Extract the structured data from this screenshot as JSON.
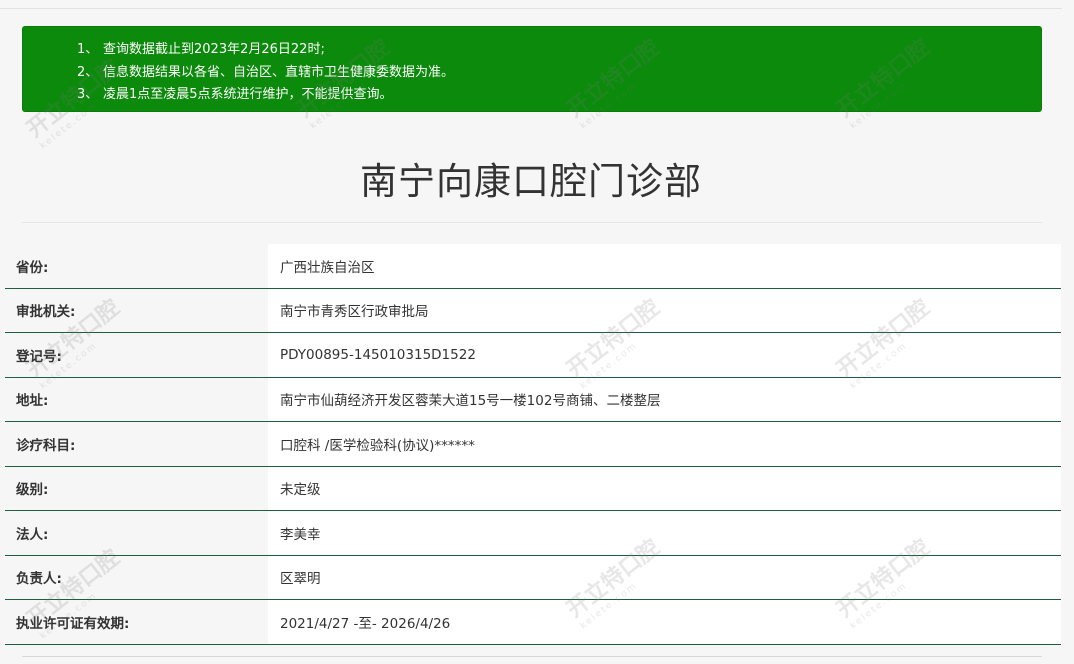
{
  "notice": {
    "items": [
      {
        "num": "1、",
        "text": "查询数据截止到2023年2月26日22时;"
      },
      {
        "num": "2、",
        "text": "信息数据结果以各省、自治区、直辖市卫生健康委数据为准。"
      },
      {
        "num": "3、",
        "text": "凌晨1点至凌晨5点系统进行维护，不能提供查询。"
      }
    ]
  },
  "clinic": {
    "name": "南宁向康口腔门诊部"
  },
  "details": {
    "rows": [
      {
        "label": "省份:",
        "value": "广西壮族自治区"
      },
      {
        "label": "审批机关:",
        "value": "南宁市青秀区行政审批局"
      },
      {
        "label": "登记号:",
        "value": "PDY00895-145010315D1522"
      },
      {
        "label": "地址:",
        "value": "南宁市仙葫经济开发区蓉茉大道15号一楼102号商铺、二楼整层"
      },
      {
        "label": "诊疗科目:",
        "value": "口腔科 /医学检验科(协议)******"
      },
      {
        "label": "级别:",
        "value": "未定级"
      },
      {
        "label": "法人:",
        "value": "李美幸"
      },
      {
        "label": "负责人:",
        "value": "区翠明"
      },
      {
        "label": "执业许可证有效期:",
        "value": "2021/4/27 -至- 2026/4/26"
      }
    ]
  },
  "watermark": {
    "text": "开立特口腔",
    "sub": "kelete.com"
  }
}
